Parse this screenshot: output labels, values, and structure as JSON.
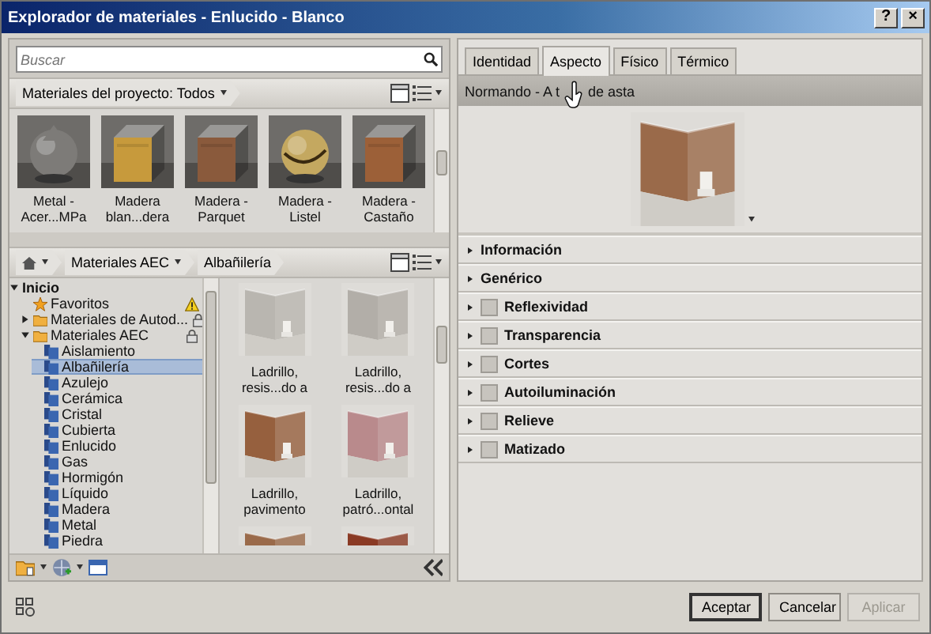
{
  "window": {
    "title": "Explorador de materiales - Enlucido - Blanco",
    "help": "?",
    "close": "×"
  },
  "search": {
    "placeholder": "Buscar"
  },
  "library": {
    "crumb": "Materiales del proyecto: Todos",
    "items": [
      {
        "label": "Metal - Acer...MPa",
        "kind": "picture"
      },
      {
        "label": "Madera blan...dera",
        "kind": "picture"
      },
      {
        "label": "Madera - Parquet",
        "kind": "picture"
      },
      {
        "label": "Madera - Listel",
        "kind": "picture"
      },
      {
        "label": "Madera - Castaño",
        "kind": "picture"
      }
    ]
  },
  "browser": {
    "crumbs": [
      "Materiales AEC",
      "Albañilería"
    ],
    "tree": [
      {
        "label": "Inicio",
        "kind": "root",
        "expanded": true,
        "selected": false,
        "children": [
          {
            "label": "Favoritos",
            "kind": "favorites",
            "selected": false
          },
          {
            "label": "Materiales de Autod...",
            "kind": "library",
            "expanded": false,
            "selected": false
          },
          {
            "label": "Materiales AEC",
            "kind": "library",
            "expanded": true,
            "selected": false,
            "children": [
              {
                "label": "Aislamiento",
                "kind": "category",
                "selected": false
              },
              {
                "label": "Albañilería",
                "kind": "category",
                "selected": true
              },
              {
                "label": "Azulejo",
                "kind": "category",
                "selected": false
              },
              {
                "label": "Cerámica",
                "kind": "category",
                "selected": false
              },
              {
                "label": "Cristal",
                "kind": "category",
                "selected": false
              },
              {
                "label": "Cubierta",
                "kind": "category",
                "selected": false
              },
              {
                "label": "Enlucido",
                "kind": "category",
                "selected": false
              },
              {
                "label": "Gas",
                "kind": "category",
                "selected": false
              },
              {
                "label": "Hormigón",
                "kind": "category",
                "selected": false
              },
              {
                "label": "Líquido",
                "kind": "category",
                "selected": false
              },
              {
                "label": "Madera",
                "kind": "category",
                "selected": false
              },
              {
                "label": "Metal",
                "kind": "category",
                "selected": false
              },
              {
                "label": "Piedra",
                "kind": "category",
                "selected": false
              }
            ]
          }
        ]
      }
    ],
    "items": [
      {
        "label": "Ladrillo, resis...do a",
        "kind": "picture"
      },
      {
        "label": "Ladrillo, resis...do a",
        "kind": "picture"
      },
      {
        "label": "Ladrillo, pavimento",
        "kind": "picture"
      },
      {
        "label": "Ladrillo, patró...ontal",
        "kind": "picture"
      },
      {
        "kind": "picture"
      },
      {
        "kind": "picture"
      }
    ]
  },
  "tabs": [
    {
      "label": "Identidad",
      "selected": false
    },
    {
      "label": "Aspecto",
      "selected": true
    },
    {
      "label": "Físico",
      "selected": false
    },
    {
      "label": "Térmico",
      "selected": false
    }
  ],
  "appearance": {
    "name_start": "Normando - A t",
    "name_end": "de asta",
    "preview": {
      "kind": "picture"
    }
  },
  "sections": [
    {
      "label": "Información",
      "kind": "plain"
    },
    {
      "label": "Genérico",
      "kind": "plain"
    },
    {
      "label": "Reflexividad",
      "kind": "checkbox",
      "checked": false
    },
    {
      "label": "Transparencia",
      "kind": "checkbox",
      "checked": false
    },
    {
      "label": "Cortes",
      "kind": "checkbox",
      "checked": false
    },
    {
      "label": "Autoiluminación",
      "kind": "checkbox",
      "checked": false
    },
    {
      "label": "Relieve",
      "kind": "checkbox",
      "checked": false
    },
    {
      "label": "Matizado",
      "kind": "checkbox",
      "checked": false
    }
  ],
  "buttons": [
    {
      "label": "Aceptar",
      "kind": "default",
      "disabled": false
    },
    {
      "label": "Cancelar",
      "kind": "normal",
      "disabled": false
    },
    {
      "label": "Aplicar",
      "kind": "normal",
      "disabled": true
    }
  ]
}
